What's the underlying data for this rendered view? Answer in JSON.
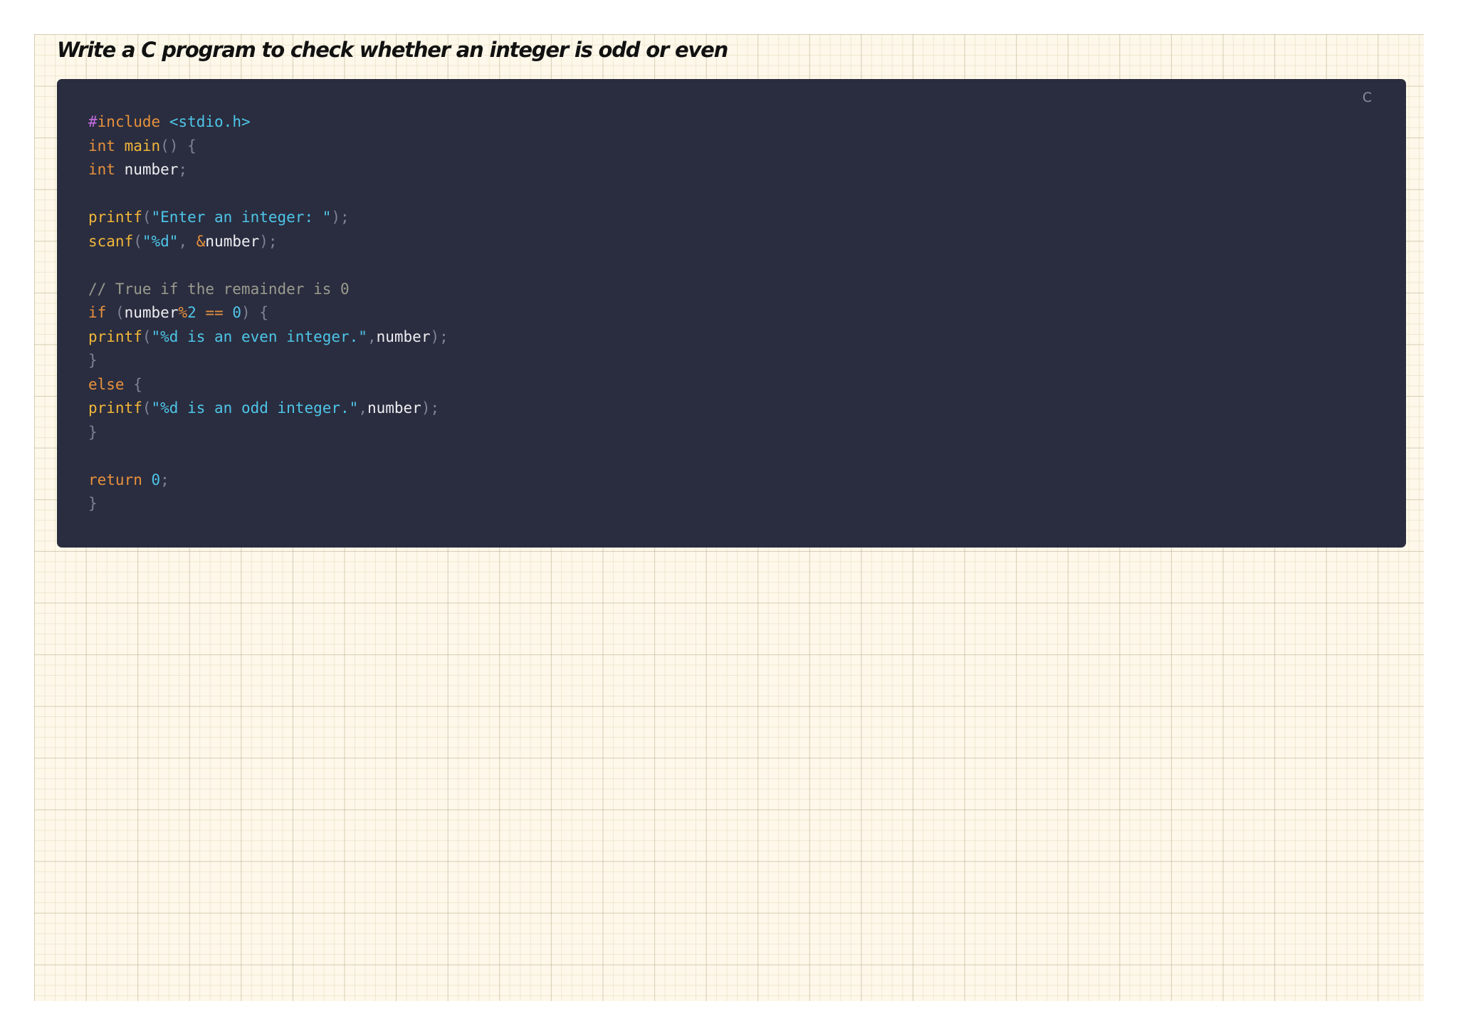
{
  "document": {
    "title": "Write a C program to check whether an integer is odd or even"
  },
  "code_block": {
    "language_label": "C",
    "lines": [
      [
        {
          "t": "pre",
          "v": "#"
        },
        {
          "t": "inc",
          "v": "include"
        },
        {
          "t": "id",
          "v": " "
        },
        {
          "t": "hdr",
          "v": "<stdio.h>"
        }
      ],
      [
        {
          "t": "kw",
          "v": "int"
        },
        {
          "t": "id",
          "v": " "
        },
        {
          "t": "fn",
          "v": "main"
        },
        {
          "t": "pn",
          "v": "() {"
        }
      ],
      [
        {
          "t": "kw",
          "v": "int"
        },
        {
          "t": "id",
          "v": " number"
        },
        {
          "t": "pn",
          "v": ";"
        }
      ],
      [],
      [
        {
          "t": "fn",
          "v": "printf"
        },
        {
          "t": "pn",
          "v": "("
        },
        {
          "t": "str",
          "v": "\"Enter an integer: \""
        },
        {
          "t": "pn",
          "v": ");"
        }
      ],
      [
        {
          "t": "fn",
          "v": "scanf"
        },
        {
          "t": "pn",
          "v": "("
        },
        {
          "t": "str",
          "v": "\"%d\""
        },
        {
          "t": "pn",
          "v": ", "
        },
        {
          "t": "op",
          "v": "&"
        },
        {
          "t": "id",
          "v": "number"
        },
        {
          "t": "pn",
          "v": ");"
        }
      ],
      [],
      [
        {
          "t": "cm",
          "v": "// True if the remainder is 0"
        }
      ],
      [
        {
          "t": "kw",
          "v": "if"
        },
        {
          "t": "id",
          "v": " "
        },
        {
          "t": "pn",
          "v": "("
        },
        {
          "t": "id",
          "v": "number"
        },
        {
          "t": "op",
          "v": "%"
        },
        {
          "t": "num",
          "v": "2"
        },
        {
          "t": "id",
          "v": " "
        },
        {
          "t": "op",
          "v": "=="
        },
        {
          "t": "id",
          "v": " "
        },
        {
          "t": "num",
          "v": "0"
        },
        {
          "t": "pn",
          "v": ") {"
        }
      ],
      [
        {
          "t": "fn",
          "v": "printf"
        },
        {
          "t": "pn",
          "v": "("
        },
        {
          "t": "str",
          "v": "\"%d is an even integer.\""
        },
        {
          "t": "pn",
          "v": ","
        },
        {
          "t": "id",
          "v": "number"
        },
        {
          "t": "pn",
          "v": ");"
        }
      ],
      [
        {
          "t": "pn",
          "v": "}"
        }
      ],
      [
        {
          "t": "kw",
          "v": "else"
        },
        {
          "t": "id",
          "v": " "
        },
        {
          "t": "pn",
          "v": "{"
        }
      ],
      [
        {
          "t": "fn",
          "v": "printf"
        },
        {
          "t": "pn",
          "v": "("
        },
        {
          "t": "str",
          "v": "\"%d is an odd integer.\""
        },
        {
          "t": "pn",
          "v": ","
        },
        {
          "t": "id",
          "v": "number"
        },
        {
          "t": "pn",
          "v": ");"
        }
      ],
      [
        {
          "t": "pn",
          "v": "}"
        }
      ],
      [],
      [
        {
          "t": "kw",
          "v": "return"
        },
        {
          "t": "id",
          "v": " "
        },
        {
          "t": "num",
          "v": "0"
        },
        {
          "t": "pn",
          "v": ";"
        }
      ],
      [
        {
          "t": "pn",
          "v": "}"
        }
      ]
    ]
  }
}
